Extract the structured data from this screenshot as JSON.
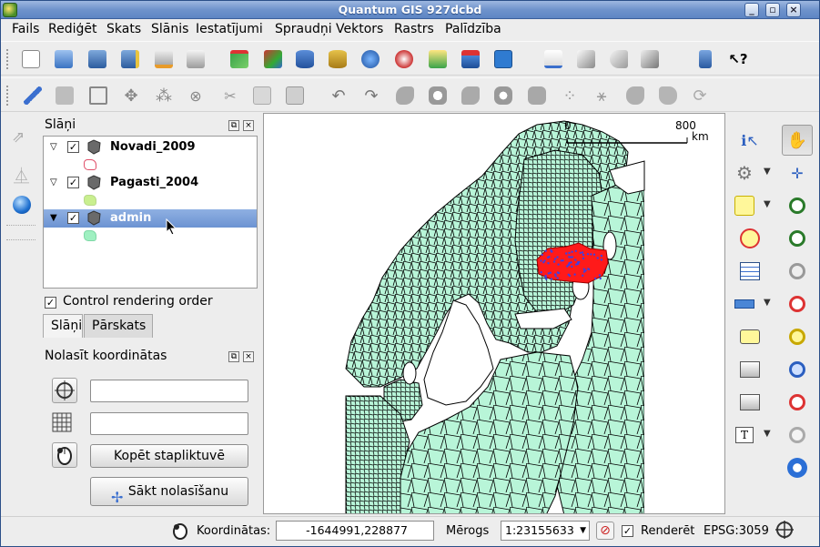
{
  "window": {
    "title": "Quantum GIS 927dcbd"
  },
  "menu": [
    "Fails",
    "Rediģēt",
    "Skats",
    "Slānis",
    "Iestatījumi",
    "Spraudņi",
    "Vektors",
    "Rastrs",
    "Palīdzība"
  ],
  "layers_panel": {
    "title": "Slāņi",
    "layers": [
      {
        "name": "Novadi_2009",
        "symbol_color": "#ffffff",
        "symbol_border": "#e0506a"
      },
      {
        "name": "Pagasti_2004",
        "symbol_color": "#c9ef8f",
        "symbol_border": "#b8d98a"
      },
      {
        "name": "admin",
        "symbol_color": "#9ff0c1",
        "symbol_border": "#7fd8a7",
        "selected": true
      }
    ],
    "control_rendering_order": "Control rendering order",
    "tabs": [
      "Slāņi",
      "Pārskats"
    ]
  },
  "coord_panel": {
    "title": "Nolasīt koordinātas",
    "field1": "",
    "field2": "",
    "copy_button": "Kopēt stapliktuvē",
    "start_button": "Sākt nolasīšanu"
  },
  "scalebar": {
    "start": "0",
    "end": "800",
    "unit": "km"
  },
  "map": {
    "land_color": "#b8f5d8",
    "highlight_color": "#ff1a1a",
    "highlight_points": "#4040e0"
  },
  "statusbar": {
    "coords_label": "Koordinātas:",
    "coords_value": "-1644991,228877",
    "scale_label": "Mērogs",
    "scale_value": "1:23155633",
    "render_label": "Renderēt",
    "crs": "EPSG:3059"
  }
}
